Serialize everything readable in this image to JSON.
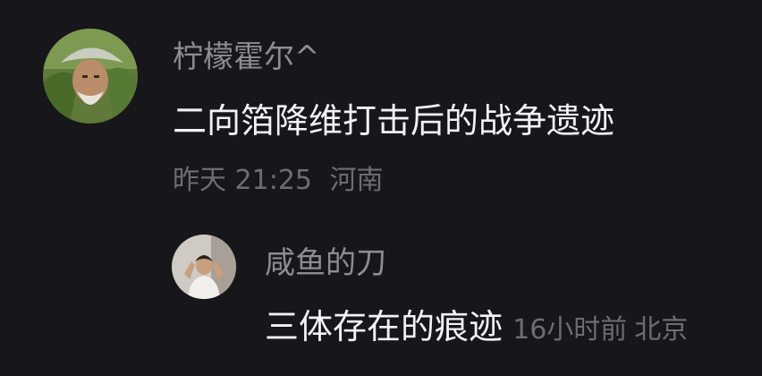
{
  "comments": [
    {
      "username": "柠檬霍尔^",
      "content": "二向箔降维打击后的战争遗迹",
      "time": "昨天 21:25",
      "location": "河南"
    },
    {
      "username": "咸鱼的刀",
      "content": "三体存在的痕迹",
      "time": "16小时前",
      "location": "北京"
    }
  ]
}
